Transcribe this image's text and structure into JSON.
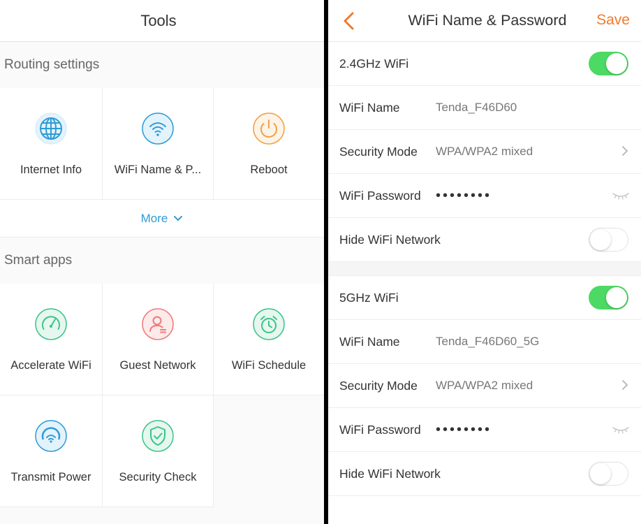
{
  "tools": {
    "title": "Tools",
    "routing": {
      "title": "Routing settings",
      "items": [
        {
          "label": "Internet Info",
          "icon": "globe-icon"
        },
        {
          "label": "WiFi Name & P...",
          "icon": "wifi-icon"
        },
        {
          "label": "Reboot",
          "icon": "power-icon"
        }
      ],
      "more_label": "More"
    },
    "smart": {
      "title": "Smart apps",
      "items": [
        {
          "label": "Accelerate WiFi",
          "icon": "speedometer-icon"
        },
        {
          "label": "Guest Network",
          "icon": "guest-user-icon"
        },
        {
          "label": "WiFi Schedule",
          "icon": "alarm-clock-icon"
        },
        {
          "label": "Transmit Power",
          "icon": "signal-icon"
        },
        {
          "label": "Security Check",
          "icon": "shield-check-icon"
        }
      ]
    }
  },
  "wifi": {
    "title": "WiFi Name & Password",
    "save_label": "Save",
    "bands": [
      {
        "band_label": "2.4GHz WiFi",
        "enabled": true,
        "name_label": "WiFi Name",
        "name_value": "Tenda_F46D60",
        "security_label": "Security Mode",
        "security_value": "WPA/WPA2 mixed",
        "password_label": "WiFi Password",
        "password_value": "••••••••",
        "hide_label": "Hide WiFi Network",
        "hide_enabled": false
      },
      {
        "band_label": "5GHz WiFi",
        "enabled": true,
        "name_label": "WiFi Name",
        "name_value": "Tenda_F46D60_5G",
        "security_label": "Security Mode",
        "security_value": "WPA/WPA2 mixed",
        "password_label": "WiFi Password",
        "password_value": "••••••••",
        "hide_label": "Hide WiFi Network",
        "hide_enabled": false
      }
    ]
  },
  "colors": {
    "accent_orange": "#f07a2a",
    "link_blue": "#2f9bd6",
    "toggle_green": "#4cd964"
  }
}
